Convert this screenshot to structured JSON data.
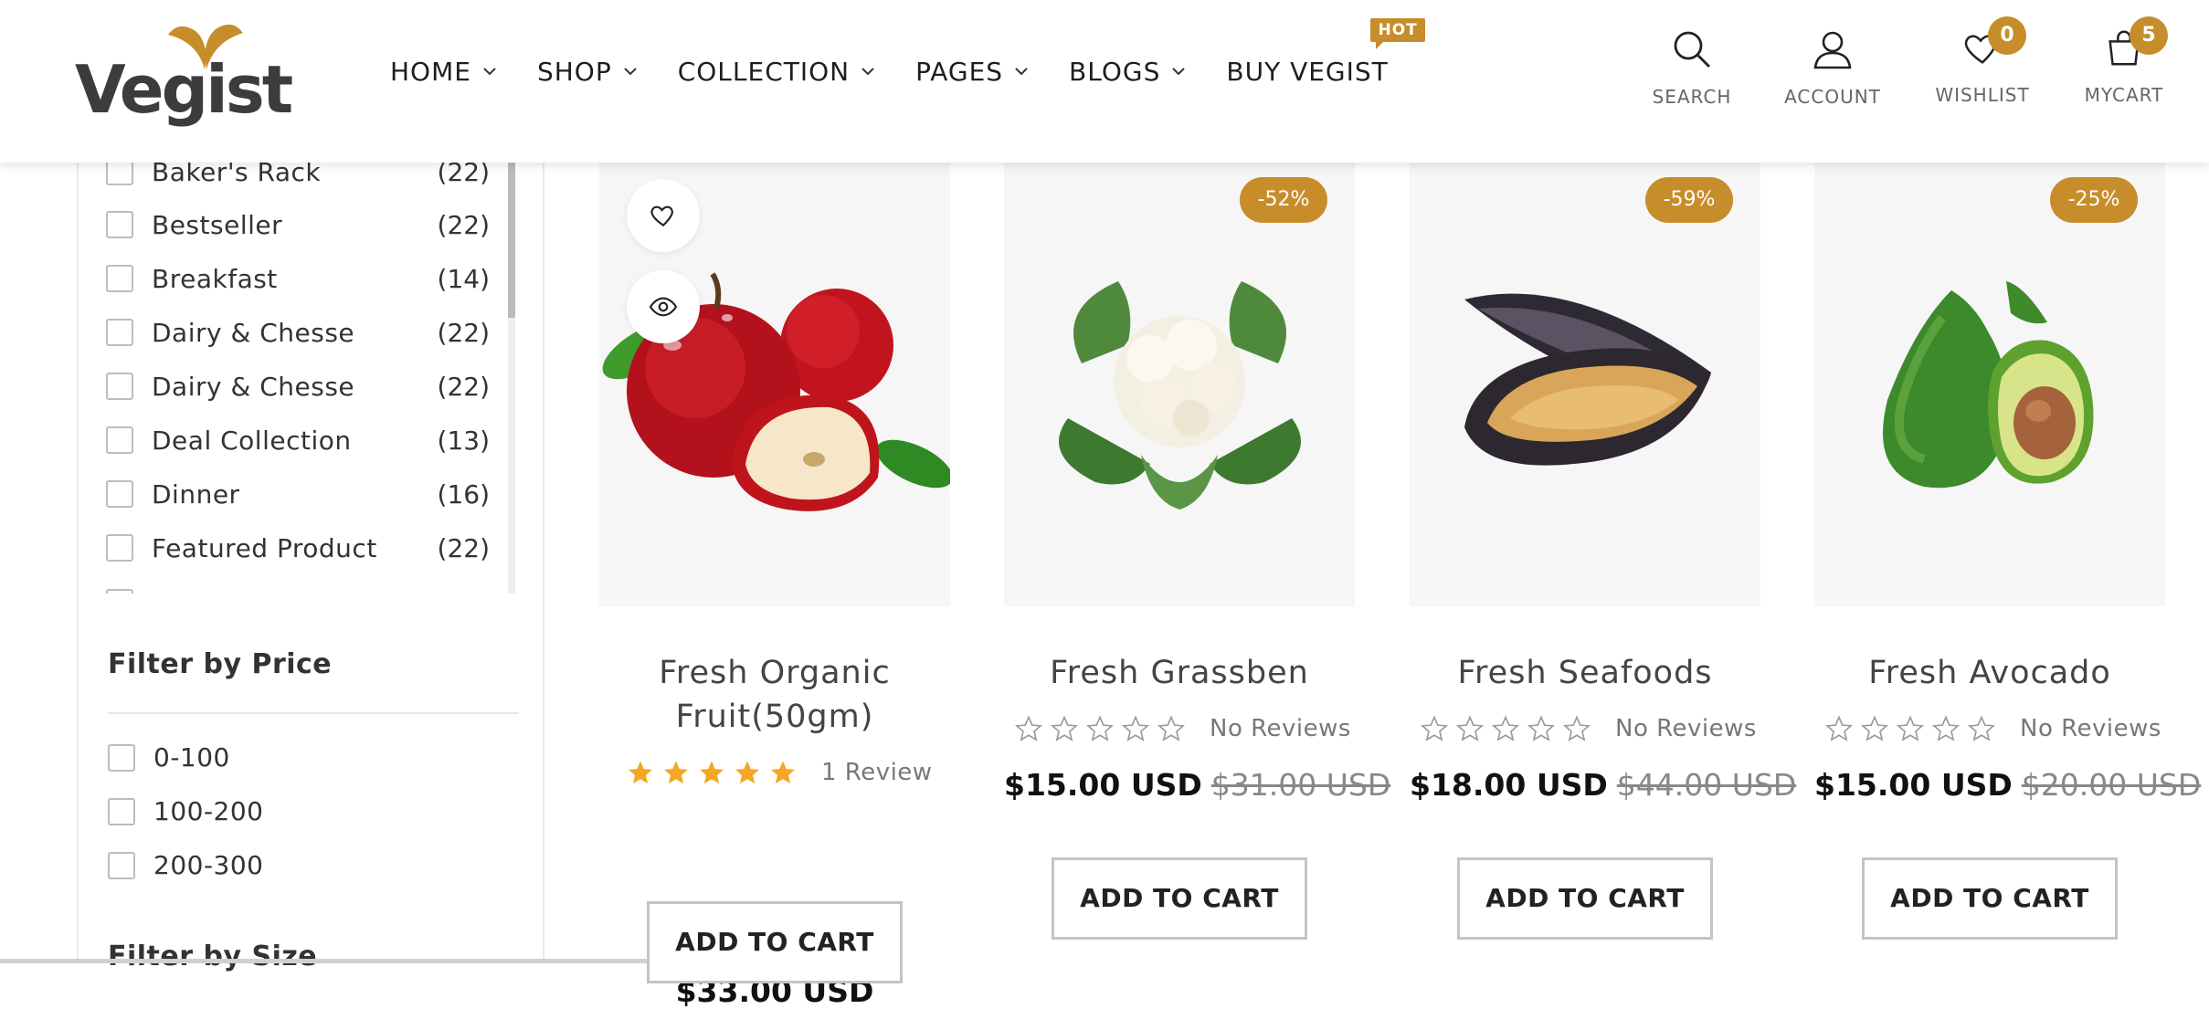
{
  "brand": {
    "name": "Vegist",
    "accent": "#c78d2a"
  },
  "nav": [
    {
      "label": "HOME",
      "has_dropdown": true
    },
    {
      "label": "SHOP",
      "has_dropdown": true
    },
    {
      "label": "COLLECTION",
      "has_dropdown": true
    },
    {
      "label": "PAGES",
      "has_dropdown": true
    },
    {
      "label": "BLOGS",
      "has_dropdown": true
    },
    {
      "label": "BUY VEGIST",
      "has_dropdown": false,
      "badge": "HOT"
    }
  ],
  "header_actions": {
    "search": {
      "label": "SEARCH",
      "icon": "search-icon"
    },
    "account": {
      "label": "ACCOUNT",
      "icon": "user-icon"
    },
    "wishlist": {
      "label": "WISHLIST",
      "icon": "heart-icon",
      "count": "0"
    },
    "cart": {
      "label": "MYCART",
      "icon": "bag-icon",
      "count": "5"
    }
  },
  "sidebar": {
    "categories": [
      {
        "name": "Baker's Rack",
        "count": "(22)"
      },
      {
        "name": "Bestseller",
        "count": "(22)"
      },
      {
        "name": "Breakfast",
        "count": "(14)"
      },
      {
        "name": "Dairy & Chesse",
        "count": "(22)"
      },
      {
        "name": "Dairy & Chesse",
        "count": "(22)"
      },
      {
        "name": "Deal Collection",
        "count": "(13)"
      },
      {
        "name": "Dinner",
        "count": "(16)"
      },
      {
        "name": "Featured Product",
        "count": "(22)"
      }
    ],
    "price_filter": {
      "title": "Filter by Price",
      "options": [
        "0-100",
        "100-200",
        "200-300"
      ]
    },
    "size_filter": {
      "title": "Filter by Size"
    }
  },
  "products": [
    {
      "title_line1": "Fresh Organic",
      "title_line2": "Fruit(50gm)",
      "image": "apple",
      "rating": 5,
      "reviews": "1 Review",
      "price": "$33.00 USD",
      "old_price": "",
      "discount": "",
      "button": "ADD TO CART"
    },
    {
      "title_line1": "Fresh Grassben",
      "title_line2": "",
      "image": "cauliflower",
      "rating": 0,
      "reviews": "No Reviews",
      "price": "$15.00 USD",
      "old_price": "$31.00 USD",
      "discount": "-52%",
      "button": "ADD TO CART"
    },
    {
      "title_line1": "Fresh Seafoods",
      "title_line2": "",
      "image": "mussel",
      "rating": 0,
      "reviews": "No Reviews",
      "price": "$18.00 USD",
      "old_price": "$44.00 USD",
      "discount": "-59%",
      "button": "ADD TO CART"
    },
    {
      "title_line1": "Fresh Avocado",
      "title_line2": "",
      "image": "avocado",
      "rating": 0,
      "reviews": "No Reviews",
      "price": "$15.00 USD",
      "old_price": "$20.00 USD",
      "discount": "-25%",
      "button": "ADD TO CART"
    }
  ]
}
